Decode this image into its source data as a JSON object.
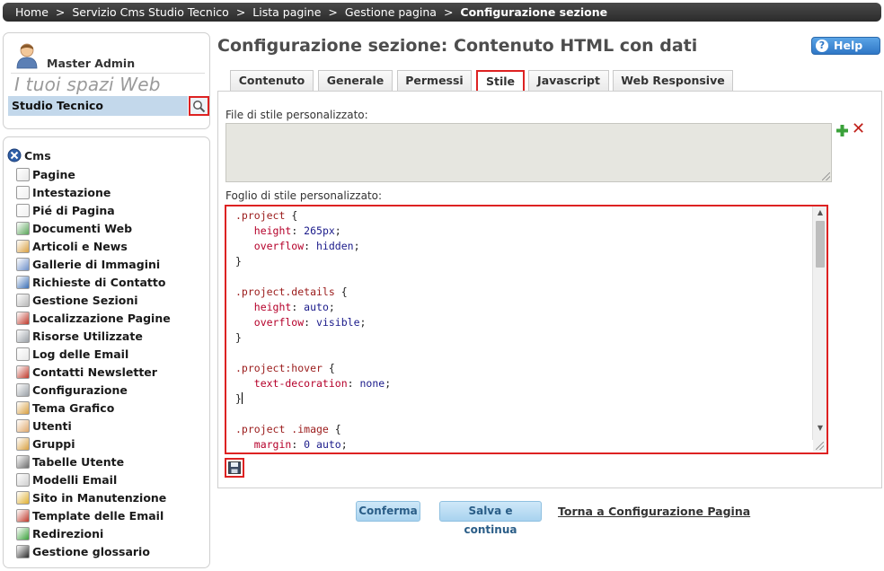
{
  "breadcrumb": {
    "items": [
      "Home",
      "Servizio Cms Studio Tecnico",
      "Lista pagine",
      "Gestione pagina"
    ],
    "current": "Configurazione sezione",
    "separator": ">"
  },
  "user": {
    "name": "Master Admin"
  },
  "spaces": {
    "title": "I tuoi spazi Web",
    "selected": "Studio Tecnico"
  },
  "nav": {
    "root_label": "Cms",
    "items": [
      {
        "label": "Pagine",
        "icon": "page-icon"
      },
      {
        "label": "Intestazione",
        "icon": "header-doc-icon"
      },
      {
        "label": "Pié di Pagina",
        "icon": "footer-doc-icon"
      },
      {
        "label": "Documenti Web",
        "icon": "web-documents-icon"
      },
      {
        "label": "Articoli e News",
        "icon": "news-icon"
      },
      {
        "label": "Gallerie di Immagini",
        "icon": "gallery-icon"
      },
      {
        "label": "Richieste di Contatto",
        "icon": "contact-request-icon"
      },
      {
        "label": "Gestione Sezioni",
        "icon": "sections-icon"
      },
      {
        "label": "Localizzazione Pagine",
        "icon": "localization-icon"
      },
      {
        "label": "Risorse Utilizzate",
        "icon": "resources-icon"
      },
      {
        "label": "Log delle Email",
        "icon": "email-log-icon"
      },
      {
        "label": "Contatti Newsletter",
        "icon": "newsletter-contacts-icon"
      },
      {
        "label": "Configurazione",
        "icon": "gear-icon"
      },
      {
        "label": "Tema Grafico",
        "icon": "palette-icon"
      },
      {
        "label": "Utenti",
        "icon": "user-icon"
      },
      {
        "label": "Gruppi",
        "icon": "group-icon"
      },
      {
        "label": "Tabelle Utente",
        "icon": "table-icon"
      },
      {
        "label": "Modelli Email",
        "icon": "email-template-icon"
      },
      {
        "label": "Sito in Manutenzione",
        "icon": "maintenance-icon"
      },
      {
        "label": "Template delle Email",
        "icon": "mail-icon"
      },
      {
        "label": "Redirezioni",
        "icon": "redirect-icon"
      },
      {
        "label": "Gestione glossario",
        "icon": "glossary-icon"
      }
    ]
  },
  "page": {
    "title": "Configurazione sezione: Contenuto HTML con dati",
    "help_label": "Help"
  },
  "tabs": [
    {
      "label": "Contenuto",
      "active": false
    },
    {
      "label": "Generale",
      "active": false
    },
    {
      "label": "Permessi",
      "active": false
    },
    {
      "label": "Stile",
      "active": true
    },
    {
      "label": "Javascript",
      "active": false
    },
    {
      "label": "Web Responsive",
      "active": false
    }
  ],
  "style_tab": {
    "file_label": "File di stile personalizzato:",
    "sheet_label": "Foglio di stile personalizzato:",
    "css_lines": [
      [
        {
          "t": ".project",
          "c": "sel"
        },
        {
          "t": " {",
          "c": "punct"
        }
      ],
      [
        {
          "t": "   height",
          "c": "prop"
        },
        {
          "t": ": ",
          "c": "punct"
        },
        {
          "t": "265px",
          "c": "val"
        },
        {
          "t": ";",
          "c": "punct"
        }
      ],
      [
        {
          "t": "   overflow",
          "c": "prop"
        },
        {
          "t": ": ",
          "c": "punct"
        },
        {
          "t": "hidden",
          "c": "val"
        },
        {
          "t": ";",
          "c": "punct"
        }
      ],
      [
        {
          "t": "}",
          "c": "punct"
        }
      ],
      [],
      [
        {
          "t": ".project.details",
          "c": "sel"
        },
        {
          "t": " {",
          "c": "punct"
        }
      ],
      [
        {
          "t": "   height",
          "c": "prop"
        },
        {
          "t": ": ",
          "c": "punct"
        },
        {
          "t": "auto",
          "c": "val"
        },
        {
          "t": ";",
          "c": "punct"
        }
      ],
      [
        {
          "t": "   overflow",
          "c": "prop"
        },
        {
          "t": ": ",
          "c": "punct"
        },
        {
          "t": "visible",
          "c": "val"
        },
        {
          "t": ";",
          "c": "punct"
        }
      ],
      [
        {
          "t": "}",
          "c": "punct"
        }
      ],
      [],
      [
        {
          "t": ".project:hover",
          "c": "sel"
        },
        {
          "t": " {",
          "c": "punct"
        }
      ],
      [
        {
          "t": "   text-decoration",
          "c": "prop"
        },
        {
          "t": ": ",
          "c": "punct"
        },
        {
          "t": "none",
          "c": "val"
        },
        {
          "t": ";",
          "c": "punct"
        }
      ],
      [
        {
          "t": "}",
          "c": "punct"
        },
        {
          "t": "",
          "c": "caret"
        }
      ],
      [],
      [
        {
          "t": ".project .image",
          "c": "sel"
        },
        {
          "t": " {",
          "c": "punct"
        }
      ],
      [
        {
          "t": "   margin",
          "c": "prop"
        },
        {
          "t": ": ",
          "c": "punct"
        },
        {
          "t": "0 auto",
          "c": "val"
        },
        {
          "t": ";",
          "c": "punct"
        }
      ]
    ]
  },
  "actions": {
    "confirm_label": "Conferma",
    "save_continue_label": "Salva e continua",
    "back_label": "Torna a Configurazione Pagina"
  },
  "colors": {
    "highlight_red": "#dd2222",
    "space_selector_bg": "#c3d8eb",
    "help_blue": "#2f77c6",
    "button_light_blue": "#a8d3ef"
  }
}
